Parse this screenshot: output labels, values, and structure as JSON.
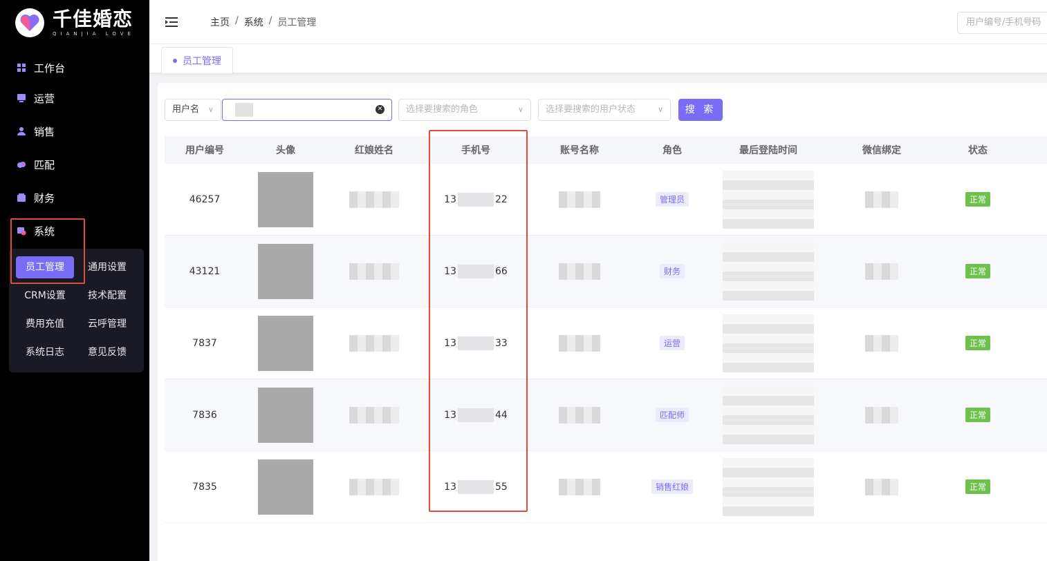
{
  "brand": {
    "title": "千佳婚恋",
    "subtitle": "QIANJIA LOVE"
  },
  "nav": {
    "items": [
      {
        "label": "工作台",
        "icon": "dashboard-icon"
      },
      {
        "label": "运营",
        "icon": "monitor-icon"
      },
      {
        "label": "销售",
        "icon": "user-icon"
      },
      {
        "label": "匹配",
        "icon": "heart-cloud-icon"
      },
      {
        "label": "财务",
        "icon": "wallet-icon"
      },
      {
        "label": "系统",
        "icon": "settings-icon"
      }
    ],
    "submenu": [
      "员工管理",
      "通用设置",
      "CRM设置",
      "技术配置",
      "费用充值",
      "云呼管理",
      "系统日志",
      "意见反馈"
    ]
  },
  "header": {
    "breadcrumb": [
      "主页",
      "系统",
      "员工管理"
    ],
    "search_placeholder": "用户编号/手机号码"
  },
  "tabs": [
    {
      "label": "员工管理"
    }
  ],
  "filters": {
    "field_select": "用户名",
    "role_placeholder": "选择要搜索的角色",
    "status_placeholder": "选择要搜索的用户状态",
    "search_button": "搜 索"
  },
  "table": {
    "columns": [
      "用户编号",
      "头像",
      "红娘姓名",
      "手机号",
      "账号名称",
      "角色",
      "最后登陆时间",
      "微信绑定",
      "状态"
    ],
    "rows": [
      {
        "id": "46257",
        "phone_prefix": "13",
        "phone_suffix": "22",
        "role": "管理员",
        "status": "正常"
      },
      {
        "id": "43121",
        "phone_prefix": "13",
        "phone_suffix": "66",
        "role": "财务",
        "status": "正常"
      },
      {
        "id": "7837",
        "phone_prefix": "13",
        "phone_suffix": "33",
        "role": "运营",
        "status": "正常"
      },
      {
        "id": "7836",
        "phone_prefix": "13",
        "phone_suffix": "44",
        "role": "匹配师",
        "status": "正常"
      },
      {
        "id": "7835",
        "phone_prefix": "13",
        "phone_suffix": "55",
        "role": "销售红娘",
        "status": "正常"
      }
    ]
  },
  "colors": {
    "accent": "#7b6cf6",
    "highlight": "#e24b3b",
    "success": "#6cc24a"
  }
}
